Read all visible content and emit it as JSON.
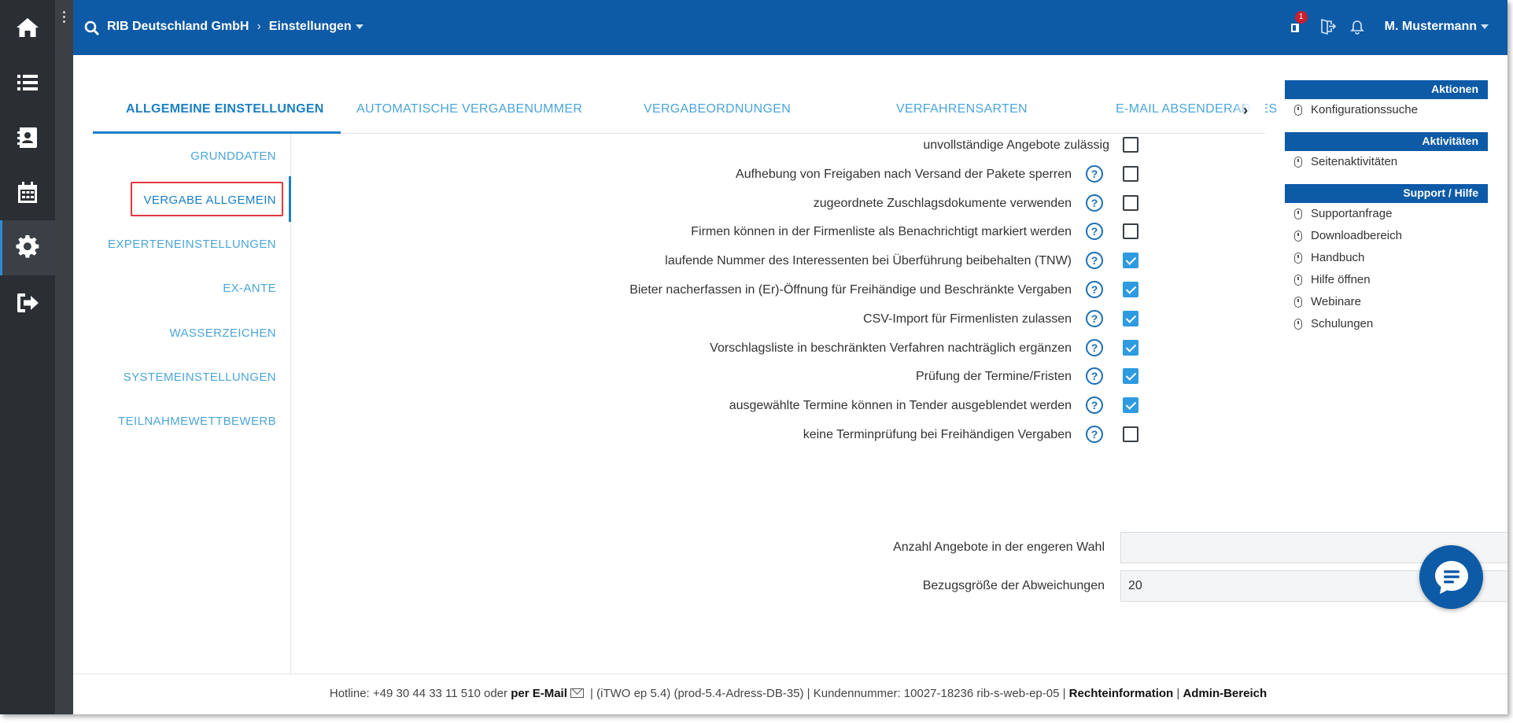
{
  "header": {
    "company": "RIB Deutschland GmbH",
    "section": "Einstellungen",
    "notification_count": "1",
    "user": "M. Mustermann"
  },
  "rail": [
    "home-icon",
    "list-icon",
    "contacts-icon",
    "calendar-icon",
    "gear-icon",
    "logout-icon"
  ],
  "tabs": [
    {
      "label": "ALLGEMEINE EINSTELLUNGEN",
      "active": true
    },
    {
      "label": "AUTOMATISCHE VERGABENUMMER"
    },
    {
      "label": "VERGABEORDNUNGEN"
    },
    {
      "label": "VERFAHRENSARTEN"
    },
    {
      "label": "E-MAIL ABSENDERADRES"
    }
  ],
  "subnav": [
    {
      "label": "GRUNDDATEN"
    },
    {
      "label": "VERGABE ALLGEMEIN",
      "active": true
    },
    {
      "label": "EXPERTENEINSTELLUNGEN"
    },
    {
      "label": "EX-ANTE"
    },
    {
      "label": "WASSERZEICHEN"
    },
    {
      "label": "SYSTEMEINSTELLUNGEN"
    },
    {
      "label": "TEILNAHMEWETTBEWERB"
    }
  ],
  "settings": [
    {
      "label": "unvollständige Angebote zulässig",
      "help": false,
      "checked": false
    },
    {
      "label": "Aufhebung von Freigaben nach Versand der Pakete sperren",
      "help": true,
      "checked": false
    },
    {
      "label": "zugeordnete Zuschlagsdokumente verwenden",
      "help": true,
      "checked": false
    },
    {
      "label": "Firmen können in der Firmenliste als Benachrichtigt markiert werden",
      "help": true,
      "checked": false
    },
    {
      "label": "laufende Nummer des Interessenten bei Überführung beibehalten (TNW)",
      "help": true,
      "checked": true
    },
    {
      "label": "Bieter nacherfassen in (Er)-Öffnung für Freihändige und Beschränkte Vergaben",
      "help": true,
      "checked": true
    },
    {
      "label": "CSV-Import für Firmenlisten zulassen",
      "help": true,
      "checked": true
    },
    {
      "label": "Vorschlagsliste in beschränkten Verfahren nachträglich ergänzen",
      "help": true,
      "checked": true
    },
    {
      "label": "Prüfung der Termine/Fristen",
      "help": true,
      "checked": true
    },
    {
      "label": "ausgewählte Termine können in Tender ausgeblendet werden",
      "help": true,
      "checked": true
    },
    {
      "label": "keine Terminprüfung bei Freihändigen Vergaben",
      "help": true,
      "checked": false
    }
  ],
  "help_glyph": "?",
  "fields": [
    {
      "label": "Anzahl Angebote in der engeren Wahl",
      "value": ""
    },
    {
      "label": "Bezugsgröße der Abweichungen",
      "value": "20"
    }
  ],
  "panel": {
    "aktionen": {
      "title": "Aktionen",
      "items": [
        "Konfigurationssuche"
      ]
    },
    "aktivitaeten": {
      "title": "Aktivitäten",
      "items": [
        "Seitenaktivitäten"
      ]
    },
    "support": {
      "title": "Support / Hilfe",
      "items": [
        "Supportanfrage",
        "Downloadbereich",
        "Handbuch",
        "Hilfe öffnen",
        "Webinare",
        "Schulungen"
      ]
    }
  },
  "footer": {
    "hotline": "Hotline: +49 30 44 33 11 510 oder",
    "email": "per E-Mail",
    "version": "| (iTWO ep 5.4) (prod-5.4-Adress-DB-35) | Kundennummer: 10027-18236 rib-s-web-ep-05 |",
    "legal": "Rechteinformation",
    "divider": "|",
    "admin": "Admin-Bereich"
  }
}
